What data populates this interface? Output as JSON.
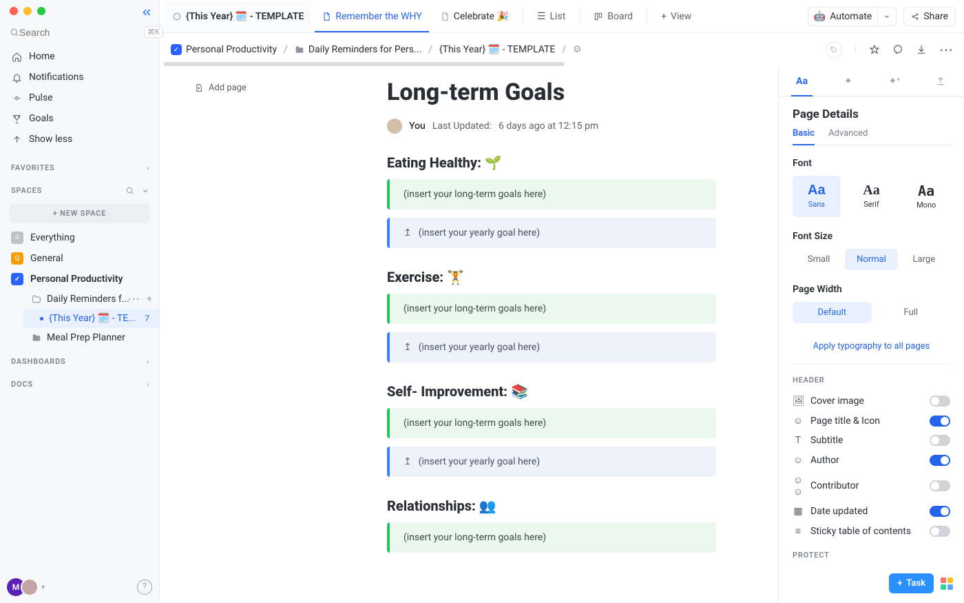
{
  "search": {
    "placeholder": "Search",
    "shortcut": "⌘K"
  },
  "nav": {
    "home": "Home",
    "notifications": "Notifications",
    "pulse": "Pulse",
    "goals": "Goals",
    "showless": "Show less"
  },
  "sections": {
    "favorites": "FAVORITES",
    "spaces": "SPACES",
    "dashboards": "DASHBOARDS",
    "docs": "DOCS",
    "newspace": "+  NEW SPACE"
  },
  "spaces": {
    "everything": "Everything",
    "general": "General",
    "personal": "Personal Productivity",
    "daily": "Daily Reminders f...",
    "thisyear": "{This Year} 🗓️ - TE...",
    "mealprep": "Meal Prep Planner",
    "badge": "7"
  },
  "tabs": {
    "t1": "{This Year} 🗓️ - TEMPLATE",
    "t2": "Remember the WHY",
    "t3": "Celebrate 🎉",
    "list": "List",
    "board": "Board",
    "view": "View",
    "automate": "Automate",
    "share": "Share"
  },
  "breadcrumb": {
    "b1": "Personal Productivity",
    "b2": "Daily Reminders for Pers...",
    "b3": "{This Year} 🗓️ - TEMPLATE"
  },
  "addpage": "Add page",
  "title": "Long-term Goals",
  "author": {
    "you": "You",
    "upd_label": "Last Updated:",
    "upd_value": "6 days ago at 12:15 pm"
  },
  "sectionsDoc": {
    "eating": "Eating Healthy: 🌱",
    "exercise": "Exercise: 🏋️",
    "self": "Self- Improvement: 📚",
    "rel": "Relationships: 👥",
    "longterm": "(insert your long-term goals here)",
    "yearly": "(insert your yearly goal here)"
  },
  "right": {
    "title": "Page Details",
    "basic": "Basic",
    "advanced": "Advanced",
    "font": "Font",
    "sans": "Sans",
    "serif": "Serif",
    "mono": "Mono",
    "Aa": "Aa",
    "fontsize": "Font Size",
    "small": "Small",
    "normal": "Normal",
    "large": "Large",
    "width": "Page Width",
    "def": "Default",
    "full": "Full",
    "applyAll": "Apply typography to all pages",
    "header": "HEADER",
    "cover": "Cover image",
    "pagetitle": "Page title & Icon",
    "subtitle": "Subtitle",
    "authorlbl": "Author",
    "contrib": "Contributor",
    "dateupd": "Date updated",
    "sticky": "Sticky table of contents",
    "protect": "PROTECT",
    "task": "Task"
  },
  "avatar": {
    "initial": "M"
  }
}
